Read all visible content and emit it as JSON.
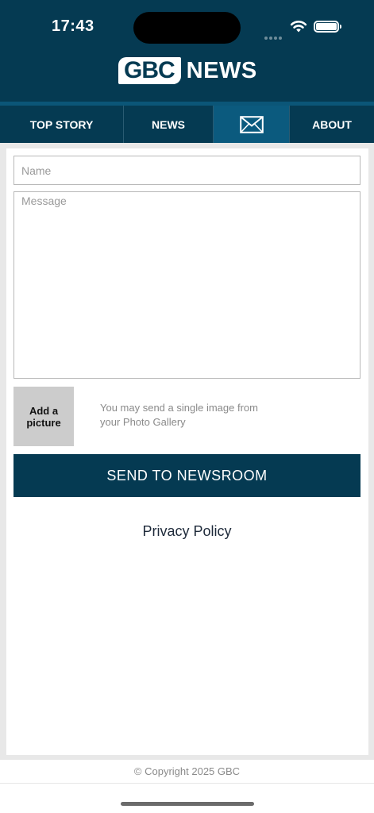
{
  "status_bar": {
    "time": "17:43"
  },
  "header": {
    "logo_box_text": "GBC",
    "logo_text": "NEWS"
  },
  "nav": {
    "items": [
      {
        "label": "TOP STORY"
      },
      {
        "label": "NEWS"
      },
      {
        "icon": "envelope-icon",
        "active": true
      },
      {
        "label": "ABOUT"
      }
    ]
  },
  "form": {
    "name_placeholder": "Name",
    "name_value": "",
    "message_placeholder": "Message",
    "message_value": "",
    "add_picture_label": "Add a picture",
    "picture_hint": "You may send a single image from your Photo Gallery",
    "send_label": "SEND TO NEWSROOM"
  },
  "privacy_link": "Privacy Policy",
  "footer": {
    "copyright": "© Copyright 2025 GBC"
  },
  "colors": {
    "brand": "#053a52",
    "nav_active": "#0b5a7e",
    "button_grey": "#cccccc"
  }
}
